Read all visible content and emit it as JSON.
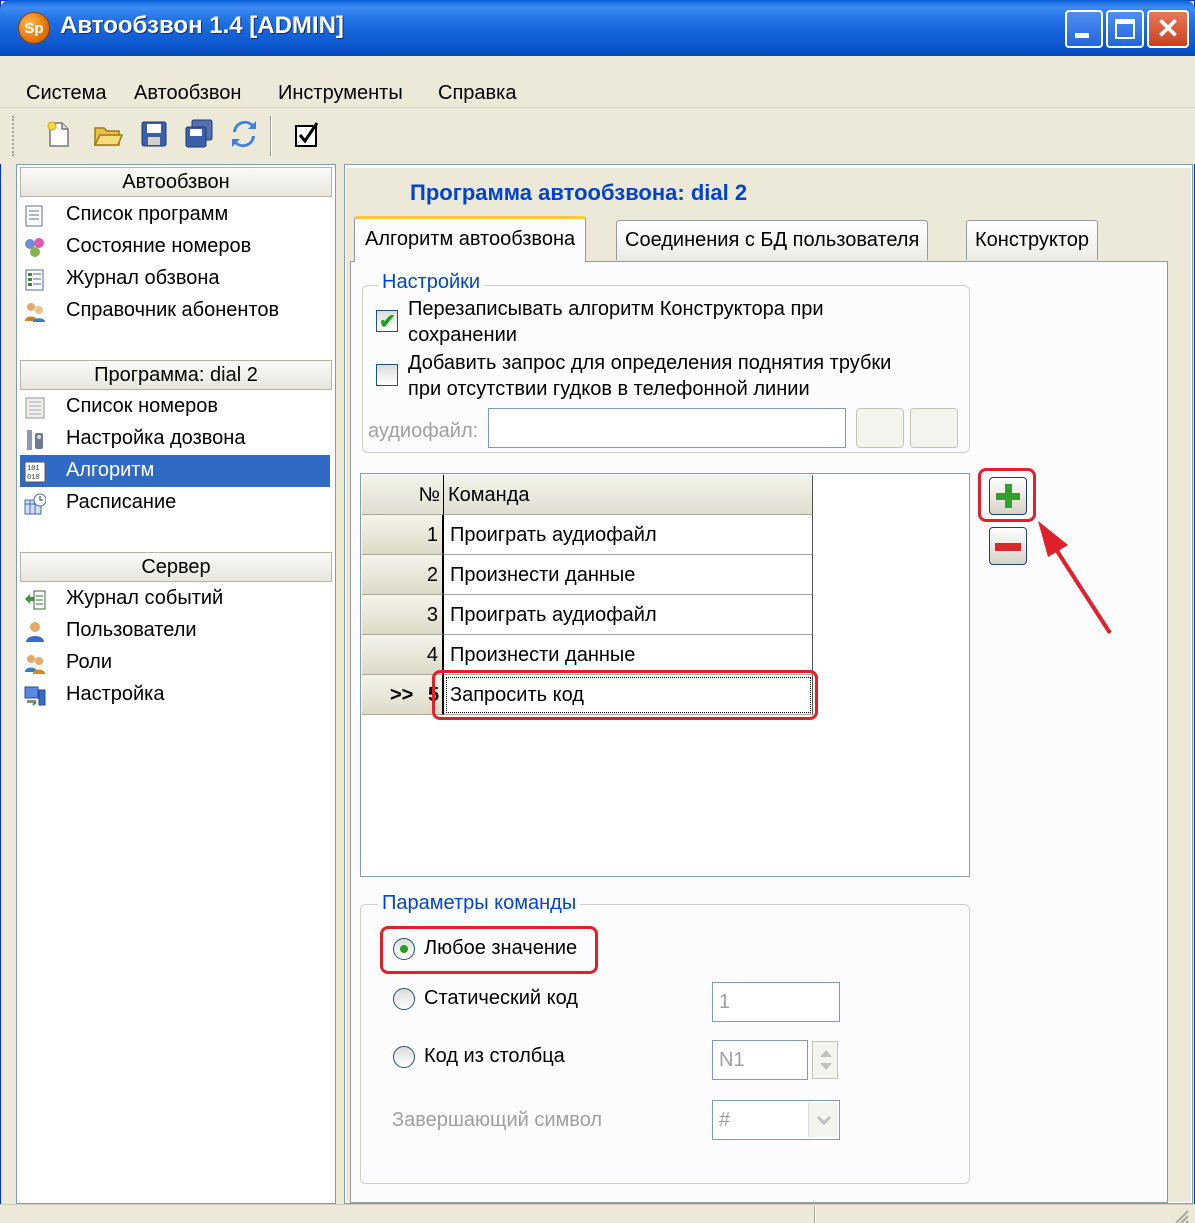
{
  "window": {
    "title": "Автообзвон 1.4 [ADMIN]",
    "logo_text": "Sp",
    "close_glyph": "✕"
  },
  "menu": {
    "items": [
      "Система",
      "Автообзвон",
      "Инструменты",
      "Справка"
    ]
  },
  "toolbar": {
    "icons": [
      "new-icon",
      "open-icon",
      "save-icon",
      "save-all-icon",
      "refresh-icon",
      "checkbox-icon"
    ]
  },
  "sidebar": {
    "sections": [
      {
        "header": "Автообзвон",
        "items": [
          {
            "label": "Список программ",
            "icon": "list-icon"
          },
          {
            "label": "Состояние номеров",
            "icon": "status-icon"
          },
          {
            "label": "Журнал обзвона",
            "icon": "journal-icon"
          },
          {
            "label": "Справочник абонентов",
            "icon": "subscribers-icon"
          }
        ]
      },
      {
        "header": "Программа: dial 2",
        "items": [
          {
            "label": "Список номеров",
            "icon": "numbers-icon"
          },
          {
            "label": "Настройка дозвона",
            "icon": "dial-settings-icon"
          },
          {
            "label": "Алгоритм",
            "icon": "algorithm-icon",
            "active": true
          },
          {
            "label": "Расписание",
            "icon": "schedule-icon"
          }
        ]
      },
      {
        "header": "Сервер",
        "items": [
          {
            "label": "Журнал событий",
            "icon": "events-icon"
          },
          {
            "label": "Пользователи",
            "icon": "user-icon"
          },
          {
            "label": "Роли",
            "icon": "roles-icon"
          },
          {
            "label": "Настройка",
            "icon": "settings-icon"
          }
        ]
      }
    ]
  },
  "main": {
    "title": "Программа автообзвона: dial 2",
    "tabs": [
      "Алгоритм автообзвона",
      "Соединения с БД пользователя",
      "Конструктор"
    ],
    "settings": {
      "legend": "Настройки",
      "options": [
        {
          "line1": "Перезаписывать алгоритм Конструктора при",
          "line2": "сохранении",
          "checked": true
        },
        {
          "line1": "Добавить запрос для определения поднятия трубки",
          "line2": "при отсутствии гудков в телефонной линии",
          "checked": false
        }
      ],
      "audio_label": "аудиофайл:",
      "audio_value": ""
    },
    "grid": {
      "headers": {
        "num": "№",
        "command": "Команда"
      },
      "current_marker": ">>",
      "rows": [
        {
          "num": "1",
          "command": "Проиграть аудиофайл"
        },
        {
          "num": "2",
          "command": "Произнести данные"
        },
        {
          "num": "3",
          "command": "Проиграть аудиофайл"
        },
        {
          "num": "4",
          "command": "Произнести данные"
        },
        {
          "num": "5",
          "command": "Запросить код",
          "current": true
        }
      ]
    },
    "params": {
      "legend": "Параметры команды",
      "options": [
        {
          "label": "Любое значение",
          "selected": true
        },
        {
          "label": "Статический код",
          "selected": false
        },
        {
          "label": "Код из столбца",
          "selected": false
        }
      ],
      "static_code_value": "1",
      "column_value": "N1",
      "terminator_label": "Завершающий символ",
      "terminator_value": "#"
    }
  },
  "colors": {
    "accent": "#0044cc",
    "selection": "#316ac5",
    "highlight_frame": "#e0202a"
  }
}
